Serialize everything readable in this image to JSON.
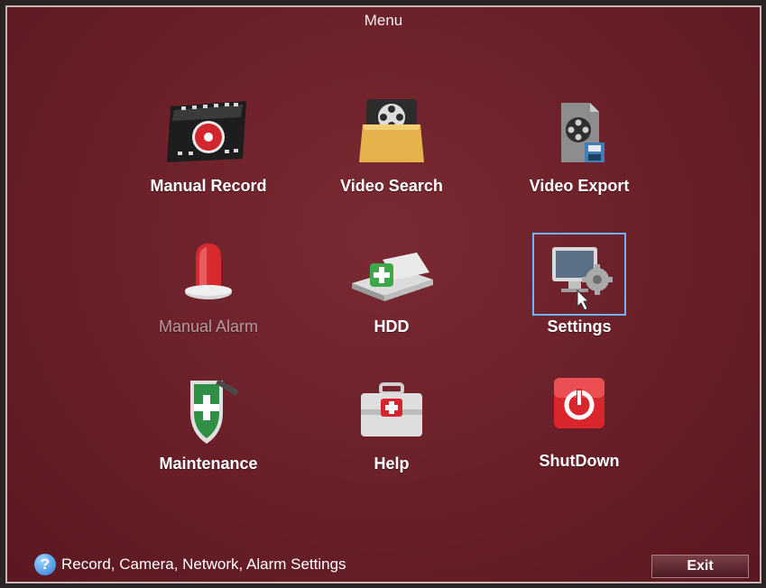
{
  "window": {
    "title": "Menu"
  },
  "tiles": [
    {
      "label": "Manual Record",
      "icon": "film-record-icon"
    },
    {
      "label": "Video Search",
      "icon": "folder-film-icon"
    },
    {
      "label": "Video Export",
      "icon": "film-export-icon"
    },
    {
      "label": "Manual Alarm",
      "icon": "siren-icon",
      "state": "disabled"
    },
    {
      "label": "HDD",
      "icon": "hdd-icon"
    },
    {
      "label": "Settings",
      "icon": "monitor-gear-icon",
      "state": "selected"
    },
    {
      "label": "Maintenance",
      "icon": "shield-wrench-icon"
    },
    {
      "label": "Help",
      "icon": "first-aid-box-icon"
    },
    {
      "label": "ShutDown",
      "icon": "power-icon"
    }
  ],
  "status_bar": {
    "help_icon_glyph": "?",
    "hint": "Record, Camera, Network, Alarm Settings"
  },
  "exit_label": "Exit",
  "colors": {
    "background": "#6a1f28",
    "selection": "#6fb3ff",
    "disabled_text": "#b49a9c"
  }
}
